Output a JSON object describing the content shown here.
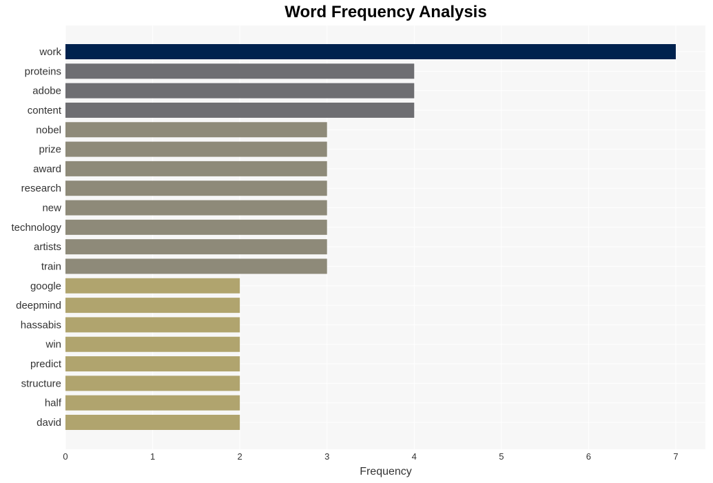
{
  "chart_data": {
    "type": "bar",
    "orientation": "horizontal",
    "title": "Word Frequency Analysis",
    "xlabel": "Frequency",
    "ylabel": "",
    "xlim": [
      0,
      7.35
    ],
    "xticks": [
      0,
      1,
      2,
      3,
      4,
      5,
      6,
      7
    ],
    "grid": true,
    "categories": [
      "work",
      "proteins",
      "adobe",
      "content",
      "nobel",
      "prize",
      "award",
      "research",
      "new",
      "technology",
      "artists",
      "train",
      "google",
      "deepmind",
      "hassabis",
      "win",
      "predict",
      "structure",
      "half",
      "david"
    ],
    "values": [
      7,
      4,
      4,
      4,
      3,
      3,
      3,
      3,
      3,
      3,
      3,
      3,
      2,
      2,
      2,
      2,
      2,
      2,
      2,
      2
    ],
    "colors": {
      "7": "#00224e",
      "4": "#6e6e72",
      "3": "#8e8a79",
      "2": "#b0a46e"
    },
    "background": "#f7f7f7",
    "gridline_color": "#ffffff"
  }
}
